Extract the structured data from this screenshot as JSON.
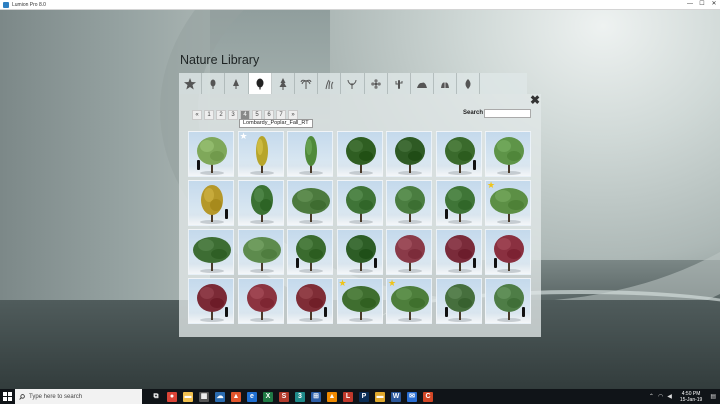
{
  "window": {
    "title": "Lumion Pro 8.0",
    "minimize": "—",
    "maximize": "☐",
    "close": "✕"
  },
  "library": {
    "title": "Nature Library",
    "tabs": [
      {
        "icon": "star-icon",
        "active": false
      },
      {
        "icon": "small-tree-icon",
        "active": false
      },
      {
        "icon": "conifer-icon",
        "active": false
      },
      {
        "icon": "broadleaf-tree-icon",
        "active": true
      },
      {
        "icon": "pine-tree-icon",
        "active": false
      },
      {
        "icon": "palm-tree-icon",
        "active": false
      },
      {
        "icon": "grass-icon",
        "active": false
      },
      {
        "icon": "plant-icon",
        "active": false
      },
      {
        "icon": "flower-icon",
        "active": false
      },
      {
        "icon": "cactus-icon",
        "active": false
      },
      {
        "icon": "rock-icon",
        "active": false
      },
      {
        "icon": "bush-icon",
        "active": false
      },
      {
        "icon": "leaf-icon",
        "active": false
      }
    ],
    "pager": {
      "prev": "«",
      "pages": [
        "1",
        "2",
        "3",
        "4",
        "5",
        "6",
        "7"
      ],
      "selected": "4",
      "next": "»"
    },
    "tooltip": "Lombardy_Poplar_Fall_RT",
    "search": {
      "label": "Search",
      "value": "",
      "placeholder": ""
    },
    "close": "✖",
    "trees": [
      {
        "color": "#7fa85a",
        "shape": "round",
        "star": false,
        "person": true
      },
      {
        "color": "#b7a52a",
        "shape": "columnar",
        "star": true,
        "person": false
      },
      {
        "color": "#4f8a3a",
        "shape": "columnar",
        "star": false,
        "person": false
      },
      {
        "color": "#2f5e22",
        "shape": "round",
        "star": false,
        "person": false
      },
      {
        "color": "#2e5a24",
        "shape": "round",
        "star": false,
        "person": false
      },
      {
        "color": "#3a6a2c",
        "shape": "round",
        "star": false,
        "person": true
      },
      {
        "color": "#5e9448",
        "shape": "round",
        "star": false,
        "person": false
      },
      {
        "color": "#b5982a",
        "shape": "oval",
        "star": false,
        "person": true
      },
      {
        "color": "#3b7233",
        "shape": "oval",
        "star": false,
        "person": false
      },
      {
        "color": "#4c7a3e",
        "shape": "wide",
        "star": false,
        "person": false
      },
      {
        "color": "#3f7437",
        "shape": "round",
        "star": false,
        "person": false
      },
      {
        "color": "#4a7d40",
        "shape": "round",
        "star": false,
        "person": false
      },
      {
        "color": "#3f7537",
        "shape": "round",
        "star": false,
        "person": true
      },
      {
        "color": "#5c8f45",
        "shape": "wide",
        "star": true,
        "person": false
      },
      {
        "color": "#3d6d33",
        "shape": "wide",
        "star": false,
        "person": false
      },
      {
        "color": "#5d8b4d",
        "shape": "wide",
        "star": false,
        "person": false
      },
      {
        "color": "#3a6b2e",
        "shape": "round",
        "star": false,
        "person": true
      },
      {
        "color": "#2d5d26",
        "shape": "round",
        "star": false,
        "person": true
      },
      {
        "color": "#8a3a48",
        "shape": "round",
        "star": false,
        "person": false
      },
      {
        "color": "#7a2b3a",
        "shape": "round",
        "star": false,
        "person": true
      },
      {
        "color": "#8a3040",
        "shape": "round",
        "star": false,
        "person": true
      },
      {
        "color": "#7b2a36",
        "shape": "round",
        "star": false,
        "person": true
      },
      {
        "color": "#8c3440",
        "shape": "round",
        "star": false,
        "person": false
      },
      {
        "color": "#7f2d36",
        "shape": "round",
        "star": false,
        "person": true
      },
      {
        "color": "#3f6e2f",
        "shape": "wide",
        "star": true,
        "person": false
      },
      {
        "color": "#4d7e3b",
        "shape": "wide",
        "star": true,
        "person": false
      },
      {
        "color": "#466f3d",
        "shape": "round",
        "star": false,
        "person": true
      },
      {
        "color": "#4e7d46",
        "shape": "round",
        "star": false,
        "person": true
      }
    ]
  },
  "taskbar": {
    "search_placeholder": "Type here to search",
    "apps": [
      {
        "icon": "task-view-icon",
        "color": "#101418",
        "glyph": "⧉"
      },
      {
        "icon": "chrome-icon",
        "color": "#db4437",
        "glyph": "●"
      },
      {
        "icon": "file-explorer-icon",
        "color": "#f2c14e",
        "glyph": "▬"
      },
      {
        "icon": "calculator-icon",
        "color": "#555555",
        "glyph": "▦"
      },
      {
        "icon": "cloud-icon",
        "color": "#2b6cb0",
        "glyph": "☁"
      },
      {
        "icon": "brave-icon",
        "color": "#e2552b",
        "glyph": "▲"
      },
      {
        "icon": "edge-icon",
        "color": "#1f6fd1",
        "glyph": "e"
      },
      {
        "icon": "excel-icon",
        "color": "#1f7a45",
        "glyph": "X"
      },
      {
        "icon": "sketchup-icon",
        "color": "#b13b2c",
        "glyph": "S"
      },
      {
        "icon": "3ds-icon",
        "color": "#1f8a8a",
        "glyph": "3"
      },
      {
        "icon": "network-icon",
        "color": "#2d5fa7",
        "glyph": "⊞"
      },
      {
        "icon": "vlc-icon",
        "color": "#f08a00",
        "glyph": "▲"
      },
      {
        "icon": "lumion-icon",
        "color": "#c0392b",
        "glyph": "L"
      },
      {
        "icon": "photoshop-icon",
        "color": "#0b2d55",
        "glyph": "P"
      },
      {
        "icon": "folder-icon",
        "color": "#e0a92d",
        "glyph": "▬"
      },
      {
        "icon": "word-icon",
        "color": "#2b579a",
        "glyph": "W"
      },
      {
        "icon": "mail-icon",
        "color": "#2a6fd4",
        "glyph": "✉"
      },
      {
        "icon": "app-icon",
        "color": "#d24726",
        "glyph": "C"
      }
    ],
    "time": "4:50 PM",
    "date": "15-Jan-19"
  }
}
